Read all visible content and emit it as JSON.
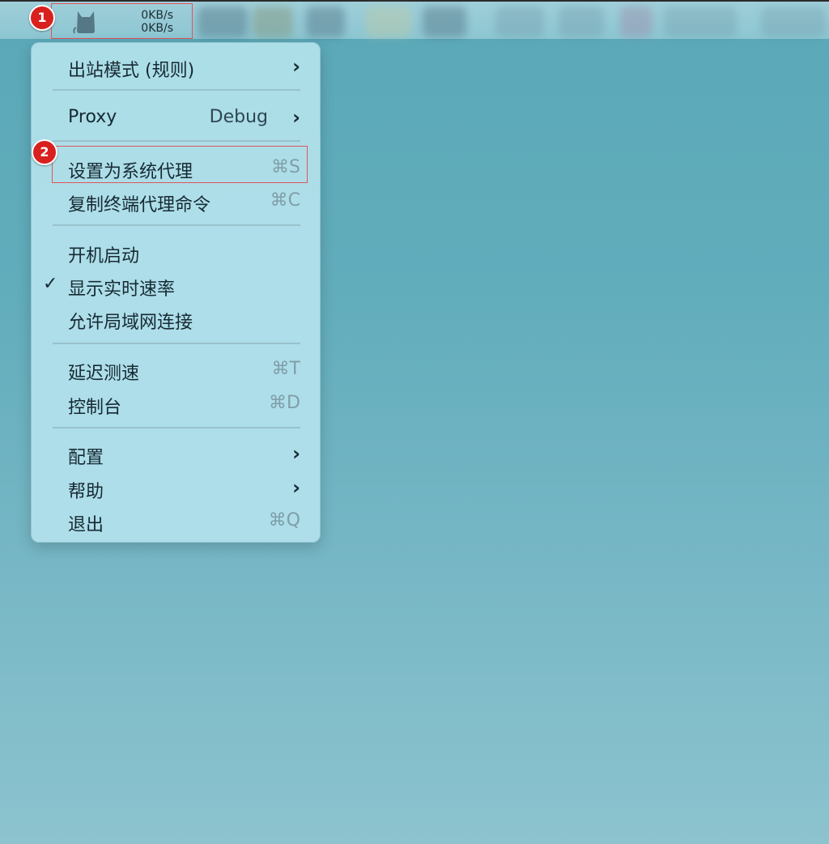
{
  "menubar": {
    "status_item": {
      "icon": "cat-icon",
      "upload_speed": "0KB/s",
      "download_speed": "0KB/s"
    }
  },
  "annotations": {
    "badge_1": "1",
    "badge_2": "2",
    "highlight_color": "#e0555a",
    "badge_color": "#d8201e"
  },
  "menu": {
    "outbound_mode": {
      "label": "出站模式 (规则)"
    },
    "proxy": {
      "label": "Proxy",
      "value": "Debug"
    },
    "set_system_proxy": {
      "label": "设置为系统代理",
      "shortcut": "⌘S"
    },
    "copy_terminal_proxy": {
      "label": "复制终端代理命令",
      "shortcut": "⌘C"
    },
    "launch_at_login": {
      "label": "开机启动"
    },
    "show_speed": {
      "label": "显示实时速率",
      "checked": "✓"
    },
    "allow_lan": {
      "label": "允许局域网连接"
    },
    "latency_test": {
      "label": "延迟测速",
      "shortcut": "⌘T"
    },
    "dashboard": {
      "label": "控制台",
      "shortcut": "⌘D"
    },
    "config": {
      "label": "配置"
    },
    "help": {
      "label": "帮助"
    },
    "quit": {
      "label": "退出",
      "shortcut": "⌘Q"
    }
  }
}
